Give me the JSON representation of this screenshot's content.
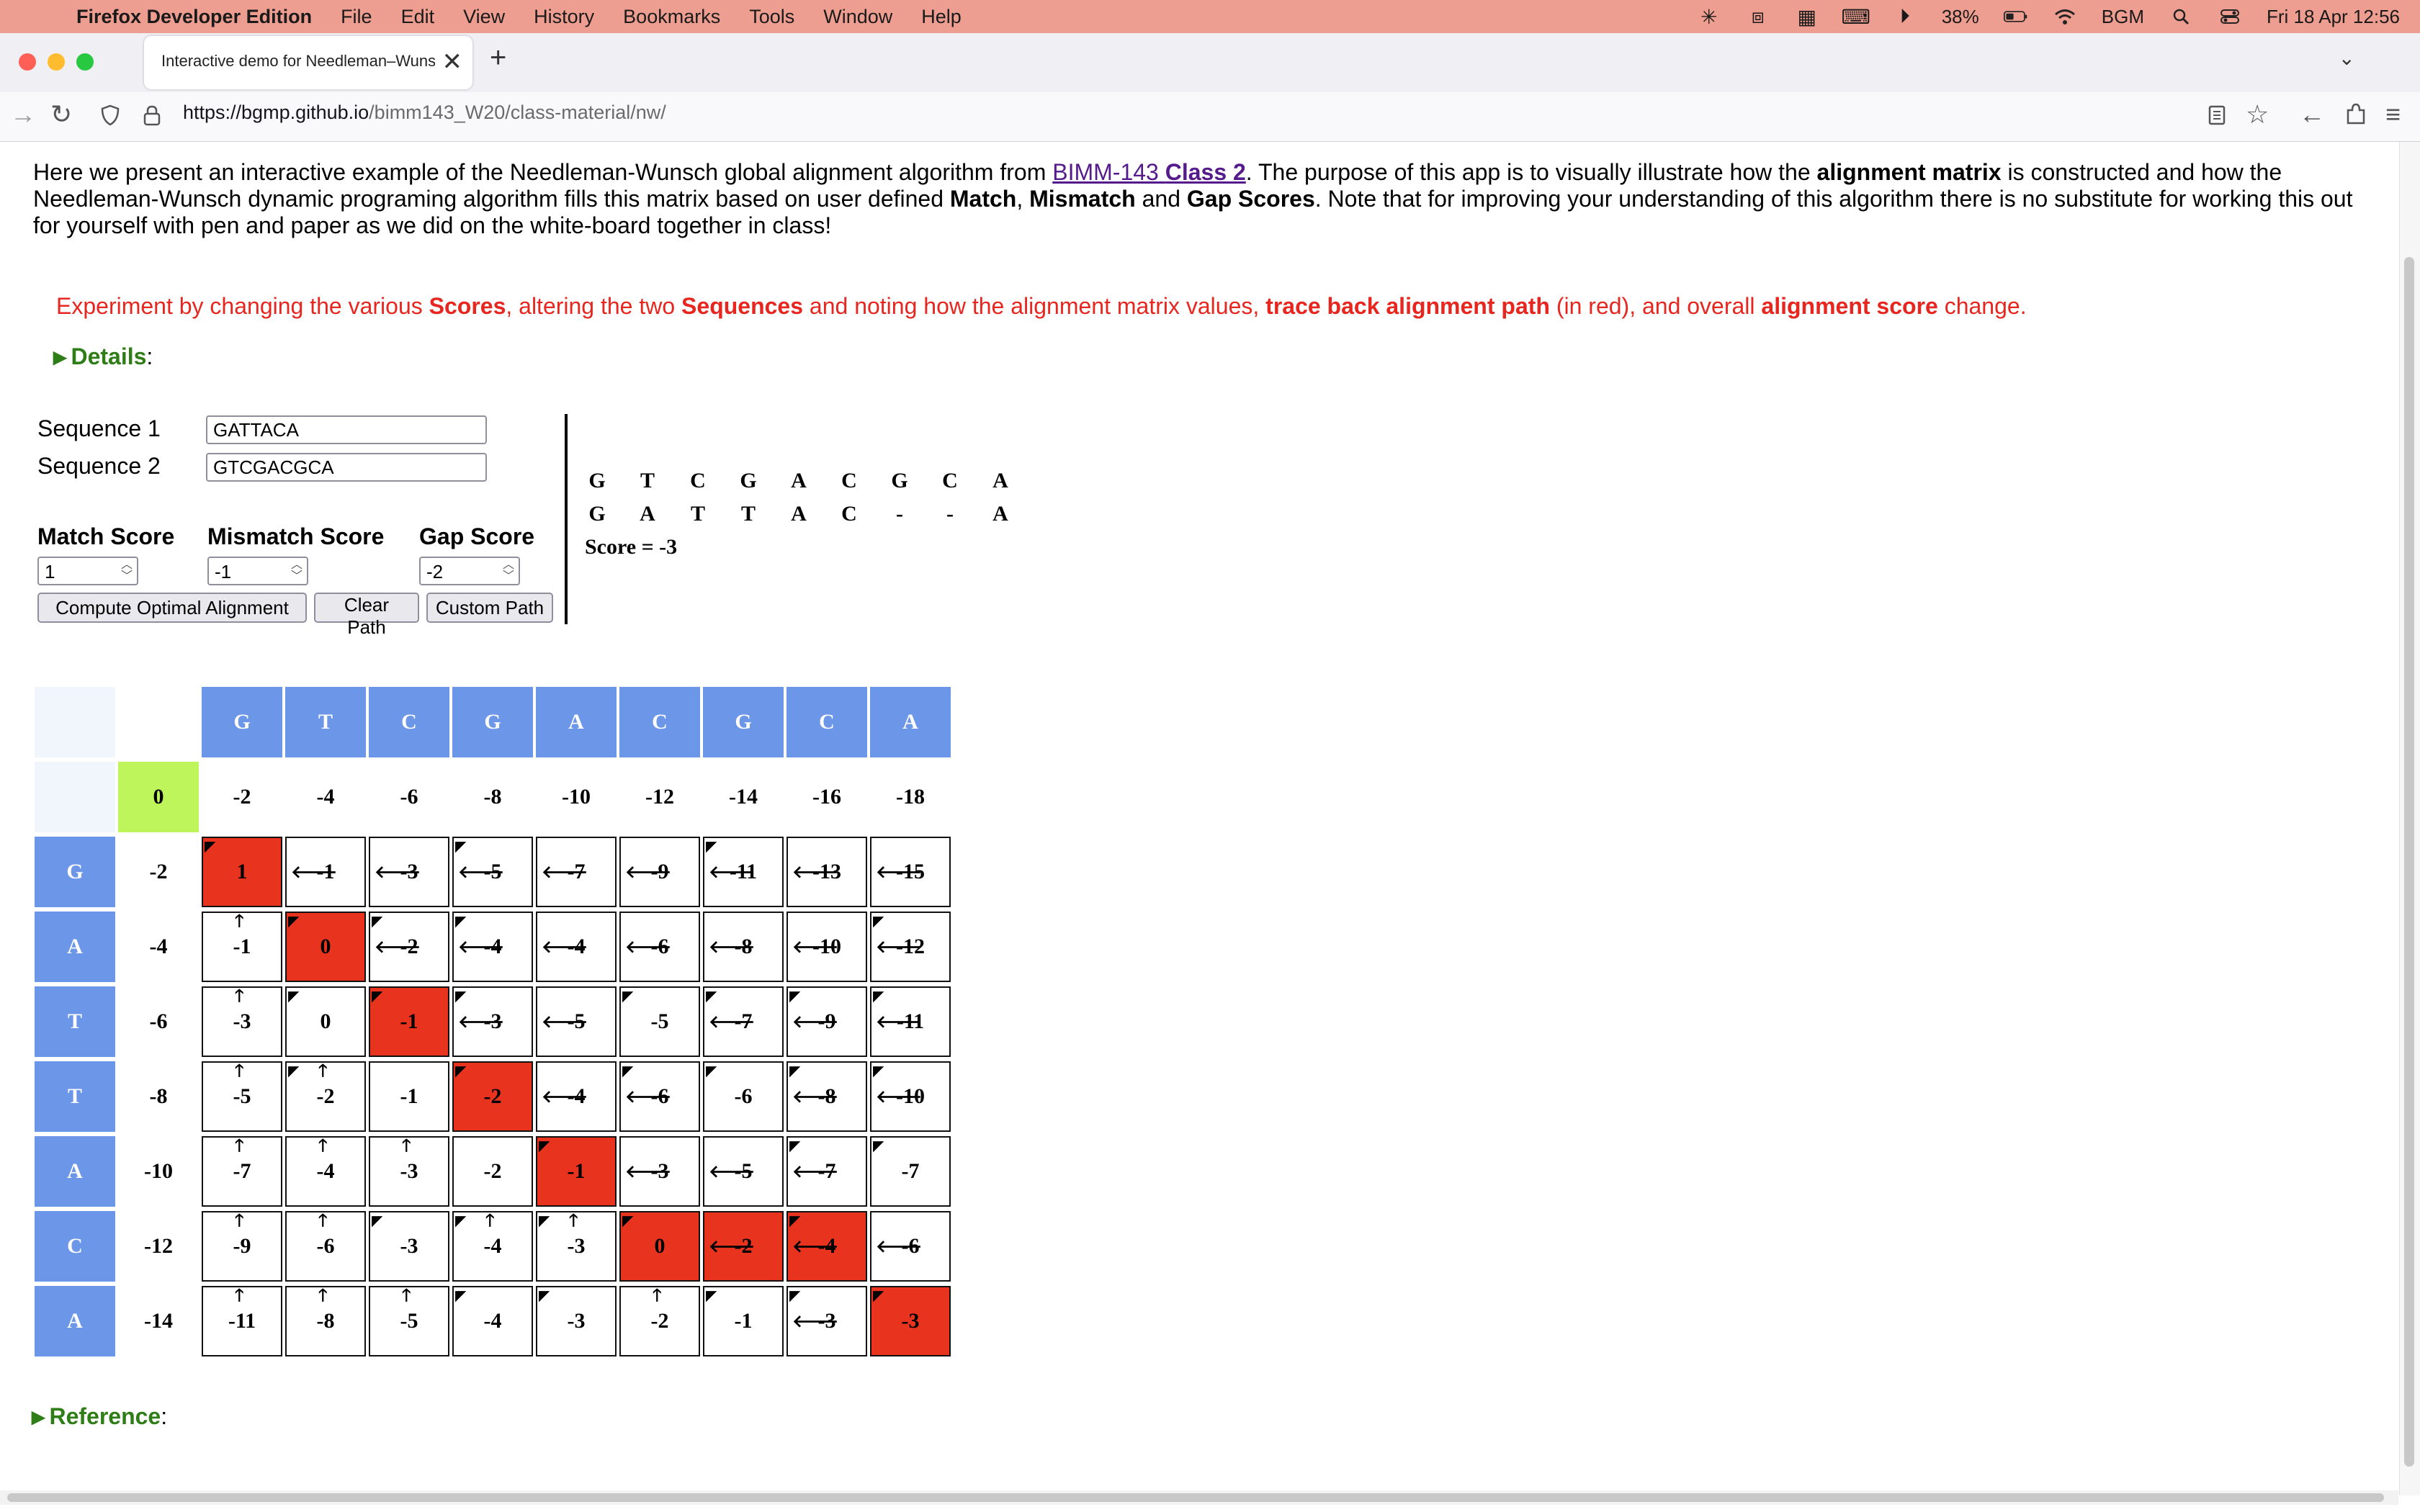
{
  "menubar": {
    "app_name": "Firefox Developer Edition",
    "menus": [
      "File",
      "Edit",
      "View",
      "History",
      "Bookmarks",
      "Tools",
      "Window",
      "Help"
    ],
    "battery": "38%",
    "user": "BGM",
    "datetime": "Fri 18 Apr  12:56"
  },
  "browser": {
    "tab_title": "Interactive demo for Needleman–Wunsch",
    "url_host": "https://bgmp.github.io",
    "url_path": "/bimm143_W20/class-material/nw/"
  },
  "page": {
    "intro_1": "Here we present an interactive example of the Needleman-Wunsch global alignment algorithm from ",
    "intro_link_1": "BIMM-143 ",
    "intro_link_2": "Class 2",
    "intro_2": ". The purpose of this app is to visually illustrate how the ",
    "intro_b1": "alignment matrix",
    "intro_3": " is constructed and how the Needleman-Wunsch dynamic programing algorithm fills this matrix based on user defined ",
    "intro_b2": "Match",
    "intro_4": ", ",
    "intro_b3": "Mismatch",
    "intro_5": " and ",
    "intro_b4": "Gap Scores",
    "intro_6": ". Note that for improving your understanding of this algorithm there is no substitute for working this out for yourself with pen and paper as we did on the white-board together in class!",
    "exp_1": "Experiment by changing the various ",
    "exp_b1": "Scores",
    "exp_2": ", altering the two ",
    "exp_b2": "Sequences",
    "exp_3": " and noting how the alignment matrix values, ",
    "exp_b3": "trace back alignment path",
    "exp_4": " (in red), and overall ",
    "exp_b4": "alignment score",
    "exp_5": " change.",
    "details_label": "Details",
    "reference_label": "Reference",
    "colon": ":"
  },
  "form": {
    "seq1_label": "Sequence 1",
    "seq1_value": "GATTACA",
    "seq2_label": "Sequence 2",
    "seq2_value": "GTCGACGCA",
    "match_label": "Match Score",
    "match_value": "1",
    "mismatch_label": "Mismatch Score",
    "mismatch_value": "-1",
    "gap_label": "Gap Score",
    "gap_value": "-2",
    "btn_compute": "Compute Optimal Alignment",
    "btn_clear": "Clear Path",
    "btn_custom": "Custom Path"
  },
  "alignment": {
    "top": [
      "G",
      "T",
      "C",
      "G",
      "A",
      "C",
      "G",
      "C",
      "A"
    ],
    "bottom": [
      "G",
      "A",
      "T",
      "T",
      "A",
      "C",
      "-",
      "-",
      "A"
    ],
    "score_text": "Score = -3"
  },
  "matrix": {
    "col_headers": [
      "G",
      "T",
      "C",
      "G",
      "A",
      "C",
      "G",
      "C",
      "A"
    ],
    "row_headers": [
      "G",
      "A",
      "T",
      "T",
      "A",
      "C",
      "A"
    ],
    "first_row": [
      "0",
      "-2",
      "-4",
      "-6",
      "-8",
      "-10",
      "-12",
      "-14",
      "-16",
      "-18"
    ],
    "first_col": [
      "-2",
      "-4",
      "-6",
      "-8",
      "-10",
      "-12",
      "-14"
    ],
    "values": [
      [
        "1",
        "-1",
        "-3",
        "-5",
        "-7",
        "-9",
        "-11",
        "-13",
        "-15"
      ],
      [
        "-1",
        "0",
        "-2",
        "-4",
        "-4",
        "-6",
        "-8",
        "-10",
        "-12"
      ],
      [
        "-3",
        "0",
        "-1",
        "-3",
        "-5",
        "-5",
        "-7",
        "-9",
        "-11"
      ],
      [
        "-5",
        "-2",
        "-1",
        "-2",
        "-4",
        "-6",
        "-6",
        "-8",
        "-10"
      ],
      [
        "-7",
        "-4",
        "-3",
        "-2",
        "-1",
        "-3",
        "-5",
        "-7",
        "-7"
      ],
      [
        "-9",
        "-6",
        "-3",
        "-4",
        "-3",
        "0",
        "-2",
        "-4",
        "-6"
      ],
      [
        "-11",
        "-8",
        "-5",
        "-4",
        "-3",
        "-2",
        "-1",
        "-3",
        "-3"
      ]
    ],
    "arrows": [
      [
        "d",
        "l",
        "l",
        "dl",
        "l",
        "l",
        "dl",
        "l",
        "l"
      ],
      [
        "u",
        "d",
        "dl",
        "dl",
        "l",
        "l",
        "l",
        "l",
        "dl"
      ],
      [
        "u",
        "d",
        "d",
        "dl",
        "l",
        "d",
        "dl",
        "dl",
        "dl"
      ],
      [
        "u",
        "du",
        "",
        "d",
        "l",
        "dl",
        "d",
        "dl",
        "dl"
      ],
      [
        "u",
        "u",
        "u",
        "",
        "d",
        "l",
        "l",
        "dl",
        "d"
      ],
      [
        "u",
        "u",
        "d",
        "du",
        "du",
        "d",
        "l",
        "dl",
        "l"
      ],
      [
        "u",
        "u",
        "u",
        "d",
        "d",
        "u",
        "d",
        "dl",
        "d"
      ]
    ],
    "path": [
      [
        0,
        0
      ],
      [
        1,
        1
      ],
      [
        2,
        2
      ],
      [
        3,
        3
      ],
      [
        4,
        4
      ],
      [
        5,
        5
      ],
      [
        5,
        6
      ],
      [
        5,
        7
      ],
      [
        6,
        8
      ]
    ],
    "colors": {
      "header": "#6c96e8",
      "path": "#e8341f",
      "start": "#bef55a"
    }
  }
}
